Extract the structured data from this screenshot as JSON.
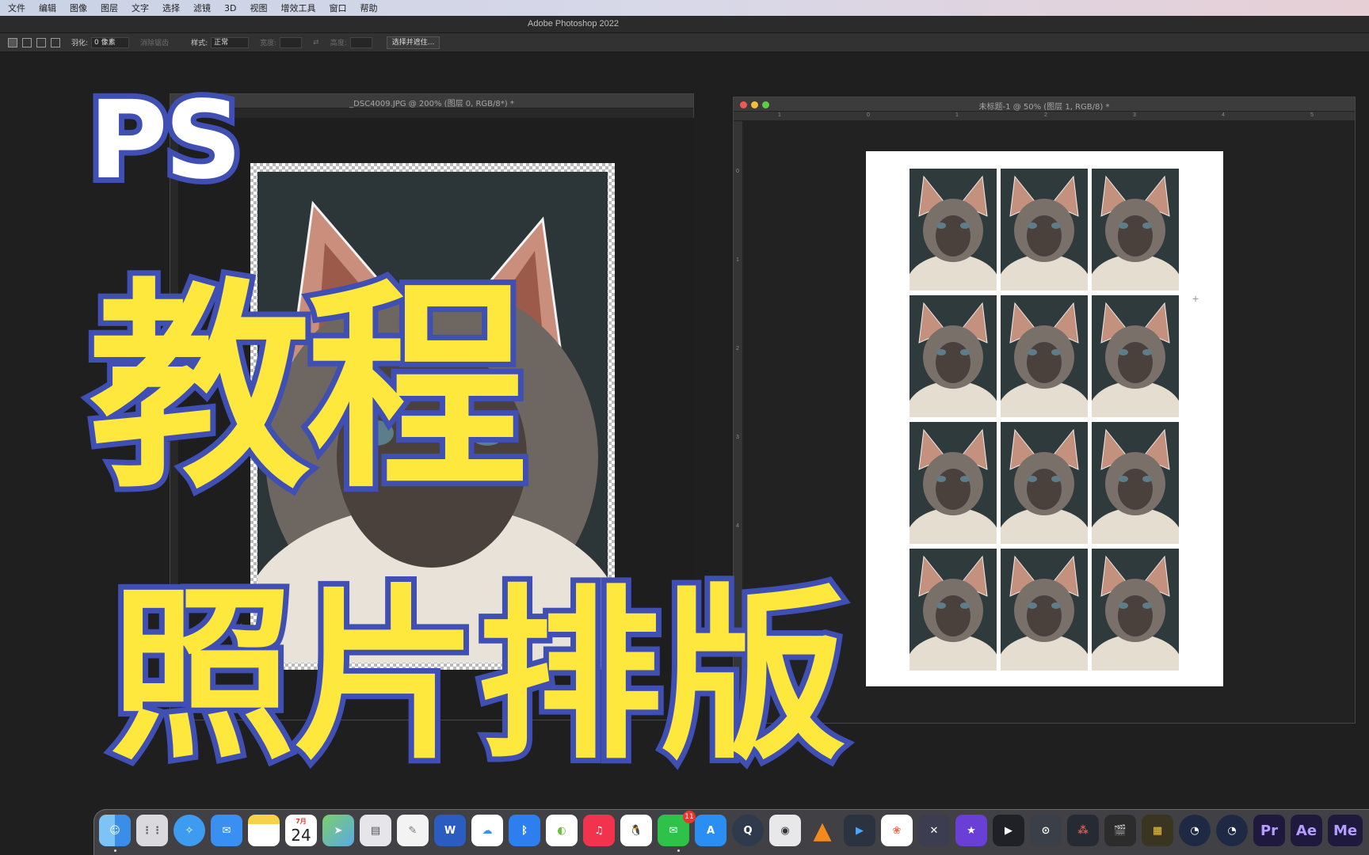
{
  "menubar": {
    "items": [
      "文件",
      "编辑",
      "图像",
      "图层",
      "文字",
      "选择",
      "滤镜",
      "3D",
      "视图",
      "增效工具",
      "窗口",
      "帮助"
    ]
  },
  "app": {
    "title": "Adobe Photoshop 2022"
  },
  "options_bar": {
    "feather_label": "羽化:",
    "feather_value": "0 像素",
    "antialias_label": "消除锯齿",
    "style_label": "样式:",
    "style_value": "正常",
    "width_label": "宽度:",
    "height_label": "高度:",
    "select_mask_button": "选择并遮住..."
  },
  "doc_left": {
    "title": "_DSC4009.JPG @ 200% (图层 0, RGB/8*) *"
  },
  "doc_right": {
    "title": "未标题-1 @ 50% (图层 1, RGB/8) *",
    "ruler_h": [
      "1",
      "0",
      "1",
      "2",
      "3",
      "4",
      "5"
    ],
    "ruler_v": [
      "0",
      "1",
      "2",
      "3",
      "4"
    ]
  },
  "overlay": {
    "line1": "PS",
    "line2": "教程",
    "line3": "照片排版"
  },
  "dock": {
    "calendar_month": "7月",
    "calendar_day": "24",
    "wechat_badge": "11",
    "premiere": "Pr",
    "after_effects": "Ae",
    "media_encoder": "Me"
  },
  "colors": {
    "overlay_fill": "#ffe83d",
    "overlay_stroke": "#3f4fb3"
  }
}
